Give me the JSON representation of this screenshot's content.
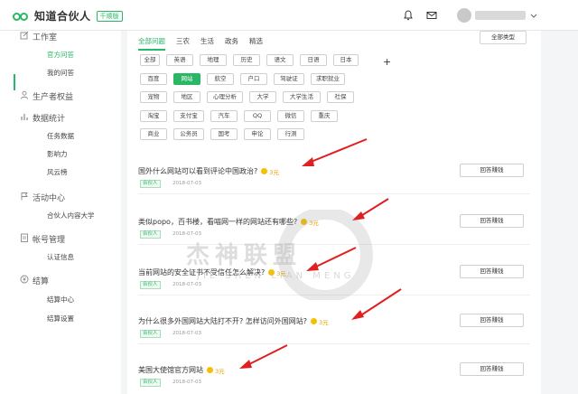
{
  "app": {
    "name": "知道合伙人",
    "version_badge": "千顺版"
  },
  "sidebar": {
    "sections": [
      {
        "label": "工作室",
        "icon": "edit-icon",
        "items": [
          {
            "label": "官方问答",
            "active": true
          },
          {
            "label": "我的问答",
            "active": false
          }
        ]
      },
      {
        "label": "生产者权益",
        "icon": "person-icon",
        "items": []
      },
      {
        "label": "数据统计",
        "icon": "bar-chart-icon",
        "items": [
          {
            "label": "任务数据",
            "active": false
          },
          {
            "label": "影响力",
            "active": false
          },
          {
            "label": "风云榜",
            "active": false
          }
        ]
      },
      {
        "label": "活动中心",
        "icon": "flag-icon",
        "items": [
          {
            "label": "合伙人内容大学",
            "active": false
          }
        ]
      },
      {
        "label": "帐号管理",
        "icon": "document-icon",
        "items": [
          {
            "label": "认证信息",
            "active": false
          }
        ]
      },
      {
        "label": "结算",
        "icon": "yen-icon",
        "items": [
          {
            "label": "结算中心",
            "active": false
          },
          {
            "label": "结算设置",
            "active": false
          }
        ]
      }
    ]
  },
  "tabs": [
    {
      "label": "全部问题",
      "active": true
    },
    {
      "label": "三农",
      "active": false
    },
    {
      "label": "生活",
      "active": false
    },
    {
      "label": "政务",
      "active": false
    },
    {
      "label": "精选",
      "active": false
    }
  ],
  "all_types_label": "全部类型",
  "plus_label": "+",
  "category_rows": [
    [
      {
        "label": "全部"
      },
      {
        "label": "英语"
      },
      {
        "label": "地理"
      },
      {
        "label": "历史"
      },
      {
        "label": "语文"
      },
      {
        "label": "日语"
      },
      {
        "label": "日本"
      }
    ],
    [
      {
        "label": "百度"
      },
      {
        "label": "网站",
        "active": true
      },
      {
        "label": "航空"
      },
      {
        "label": "户口"
      },
      {
        "label": "驾驶证"
      },
      {
        "label": "求职就业"
      }
    ],
    [
      {
        "label": "宠物"
      },
      {
        "label": "地区"
      },
      {
        "label": "心理分析"
      },
      {
        "label": "大学"
      },
      {
        "label": "大学生活"
      },
      {
        "label": "社保"
      }
    ],
    [
      {
        "label": "淘宝"
      },
      {
        "label": "支付宝"
      },
      {
        "label": "汽车"
      },
      {
        "label": "QQ"
      },
      {
        "label": "微信"
      },
      {
        "label": "重庆"
      }
    ],
    [
      {
        "label": "商业"
      },
      {
        "label": "公务员"
      },
      {
        "label": "国考"
      },
      {
        "label": "申论"
      },
      {
        "label": "行测"
      }
    ]
  ],
  "questions": [
    {
      "title": "国外什么网站可以看到评论中国政治?",
      "reward": "3元",
      "tag": "合伙人",
      "date": "2018-07-03",
      "button": "回答赚钱"
    },
    {
      "title": "类似popo，百书楼，看喵网一样的网站还有哪些?",
      "reward": "3元",
      "tag": "合伙人",
      "date": "2018-07-03",
      "button": "回答赚钱"
    },
    {
      "title": "当前网站的安全证书不受信任怎么解决?",
      "reward": "3元",
      "tag": "合伙人",
      "date": "2018-07-03",
      "button": "回答赚钱"
    },
    {
      "title": "为什么很多外国网站大陆打不开? 怎样访问外国网站?",
      "reward": "3元",
      "tag": "合伙人",
      "date": "2018-07-03",
      "button": "回答赚钱"
    },
    {
      "title": "美国大使馆官方网站",
      "reward": "3元",
      "tag": "合伙人",
      "date": "2018-07-03",
      "button": "回答赚钱"
    }
  ],
  "watermark": {
    "text": "杰神联盟",
    "subtext": "JIE SHEN LIAN MENG"
  },
  "colors": {
    "accent": "#29b765",
    "arrow": "#e02020",
    "reward": "#f0a000"
  }
}
